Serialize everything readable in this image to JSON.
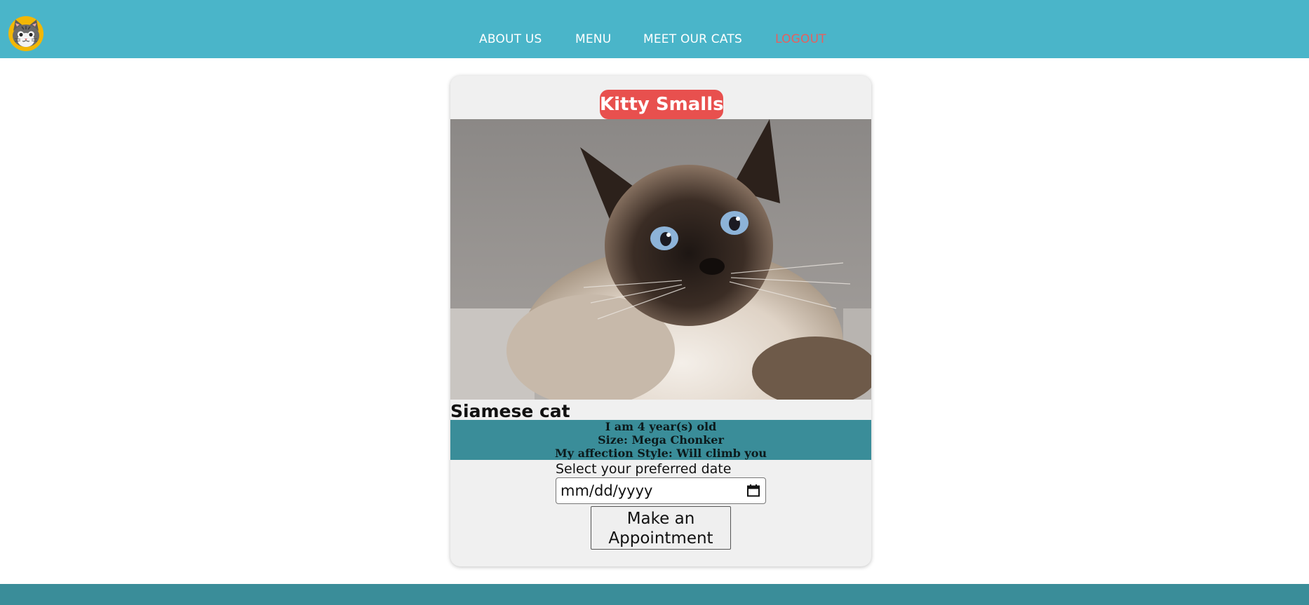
{
  "header": {
    "logo_icon": "cat-face-logo-icon",
    "nav": {
      "about": "ABOUT US",
      "menu": "MENU",
      "cats": "MEET OUR CATS",
      "logout": "LOGOUT"
    }
  },
  "cat": {
    "name": "Kitty Smalls",
    "photo_icon": "siamese-cat-photo",
    "breed": "Siamese cat",
    "age_line": "I am 4 year(s) old",
    "size_line": "Size: Mega Chonker",
    "affection_line": "My affection Style: Will climb you"
  },
  "appointment": {
    "date_label": "Select your preferred date",
    "date_placeholder": "mm/dd/yyyy",
    "button_label": "Make an Appointment"
  },
  "colors": {
    "header": "#4ab5c9",
    "footer": "#3a8d99",
    "info_band": "#3a8d99",
    "name_badge": "#e8504e",
    "logout": "#e6605f",
    "card": "#f0f0f0"
  }
}
